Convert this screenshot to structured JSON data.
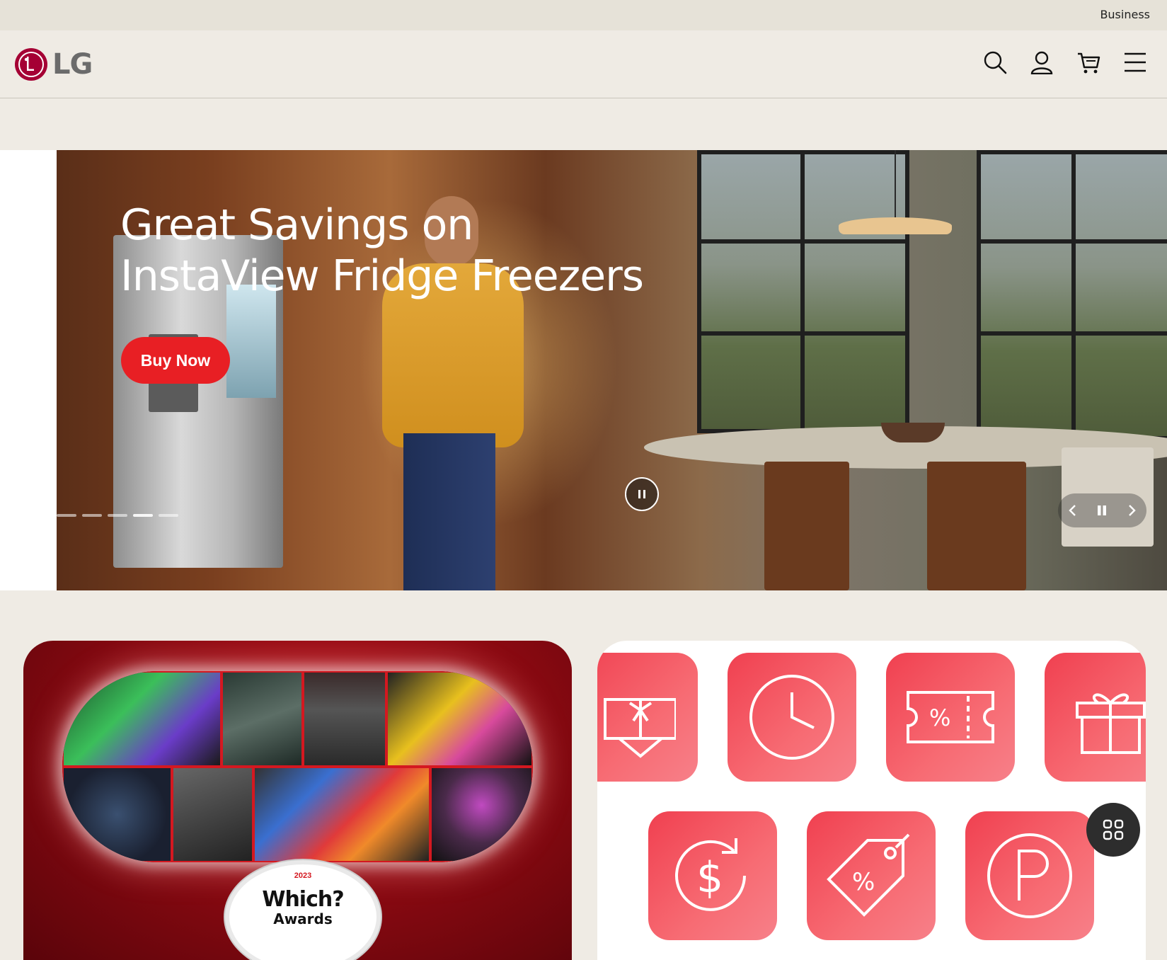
{
  "utility_bar": {
    "business_label": "Business"
  },
  "header": {
    "logo_text": "LG",
    "icons": [
      "search-icon",
      "account-icon",
      "cart-icon",
      "menu-icon"
    ]
  },
  "hero": {
    "title_line1": "Great Savings on",
    "title_line2": "InstaView Fridge Freezers",
    "cta_label": "Buy Now",
    "slide_count": 5,
    "active_slide": 4,
    "controls": [
      "prev-icon",
      "pause-icon",
      "next-icon"
    ],
    "cta_color": "#e81f24"
  },
  "promo_left": {
    "award_year": "2023",
    "award_brand": "Which?",
    "award_label": "Awards"
  },
  "promo_right": {
    "icons": [
      "gift-card-icon",
      "clock-icon",
      "coupon-icon",
      "gift-box-icon",
      "cashback-icon",
      "discount-tag-icon",
      "points-icon"
    ],
    "accent": "#f04050"
  },
  "fab": {
    "icon": "grid-icon"
  },
  "colors": {
    "brand": "#a50034",
    "background": "#efebe4"
  }
}
